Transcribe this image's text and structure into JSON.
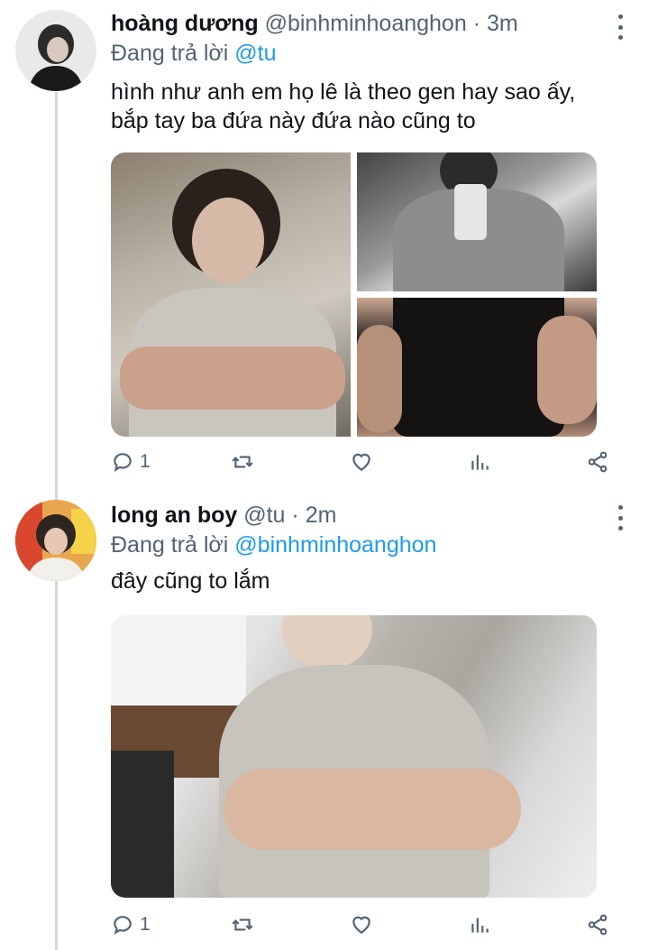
{
  "tweets": [
    {
      "name": "hoàng dương",
      "handle": "@binhminhoanghon",
      "dot": "·",
      "time": "3m",
      "reply_prefix": "Đang trả lời",
      "reply_to": "@tu",
      "text": "hình như anh em họ lê là theo gen hay sao ấy, bắp tay ba đứa này đứa nào cũng to",
      "reply_count": "1",
      "avatar_icon": "avatar-photo",
      "media_count": 3
    },
    {
      "name": "long an boy",
      "handle": "@tu",
      "dot": "·",
      "time": "2m",
      "reply_prefix": "Đang trả lời",
      "reply_to": "@binhminhoanghon",
      "text": "đây cũng to lắm",
      "reply_count": "1",
      "avatar_icon": "avatar-photo",
      "media_count": 1
    }
  ],
  "icons": {
    "reply": "reply-icon",
    "retweet": "retweet-icon",
    "like": "heart-icon",
    "views": "views-icon",
    "share": "share-icon",
    "more": "more-vertical-icon"
  },
  "colors": {
    "link": "#1d9bf0",
    "secondary": "#536471",
    "thread_line": "#cfd9de"
  }
}
